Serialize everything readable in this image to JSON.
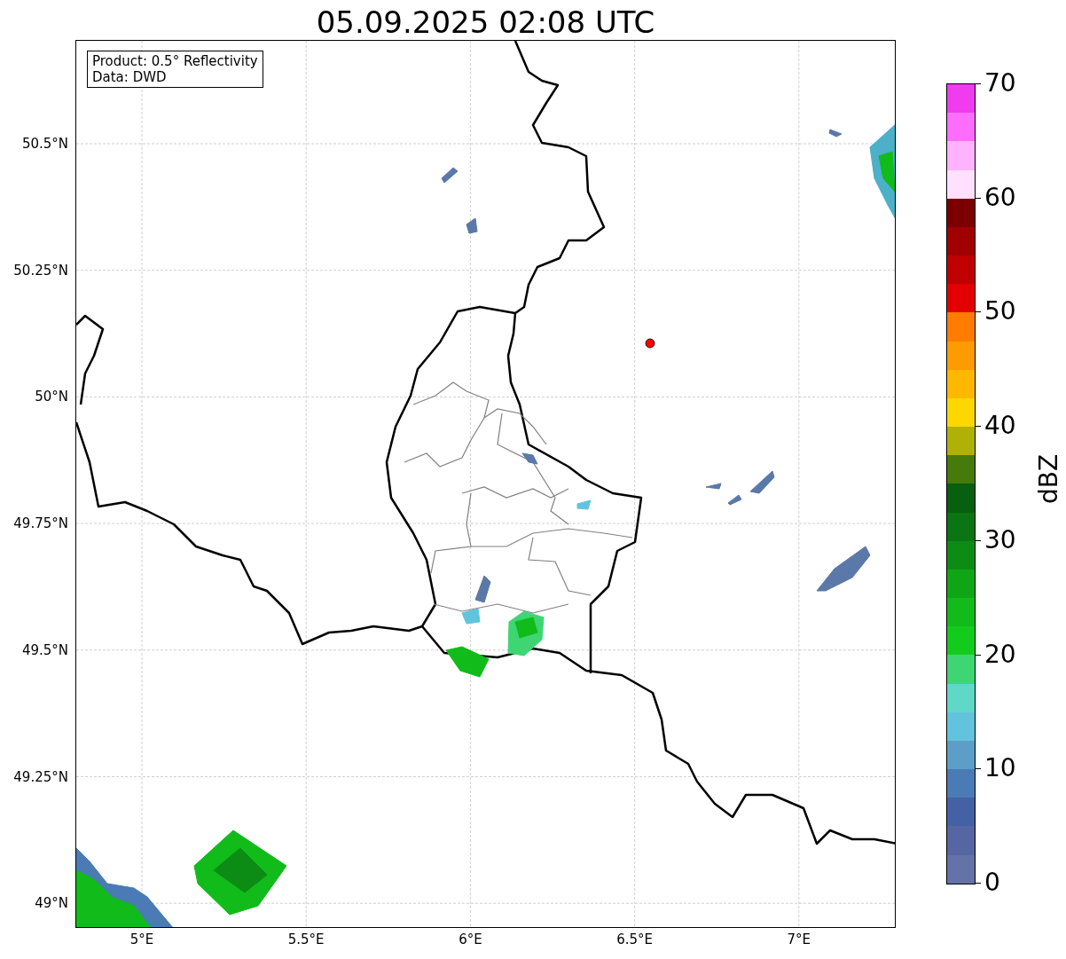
{
  "title": "05.09.2025 02:08 UTC",
  "info_box": [
    "Product: 0.5° Reflectivity",
    "Data: DWD"
  ],
  "map": {
    "lat_ticks": [
      "50.5°N",
      "50.25°N",
      "50°N",
      "49.75°N",
      "49.5°N",
      "49.25°N",
      "49°N"
    ],
    "lon_ticks": [
      "5°E",
      "5.5°E",
      "6°E",
      "6.5°E",
      "7°E"
    ]
  },
  "colorbar": {
    "label": "dBZ",
    "ticks": [
      "70",
      "60",
      "50",
      "40",
      "30",
      "20",
      "10",
      "0"
    ],
    "segments": [
      {
        "color": "#ee3cee"
      },
      {
        "color": "#ff6dff"
      },
      {
        "color": "#ffb3ff"
      },
      {
        "color": "#ffe0ff"
      },
      {
        "color": "#7c0000"
      },
      {
        "color": "#a00000"
      },
      {
        "color": "#c00000"
      },
      {
        "color": "#e20100"
      },
      {
        "color": "#fe7c00"
      },
      {
        "color": "#fe9b00"
      },
      {
        "color": "#feb800"
      },
      {
        "color": "#fed700"
      },
      {
        "color": "#b0b106"
      },
      {
        "color": "#467a0a"
      },
      {
        "color": "#075f10"
      },
      {
        "color": "#0a7512"
      },
      {
        "color": "#0c8c14"
      },
      {
        "color": "#0fa616"
      },
      {
        "color": "#10bb1a"
      },
      {
        "color": "#13cb1b"
      },
      {
        "color": "#3ed673"
      },
      {
        "color": "#5fd8c8"
      },
      {
        "color": "#62c3dc"
      },
      {
        "color": "#5b9fc8"
      },
      {
        "color": "#4a7bb5"
      },
      {
        "color": "#4461a5"
      },
      {
        "color": "#5566a2"
      },
      {
        "color": "#6373a8"
      }
    ]
  }
}
